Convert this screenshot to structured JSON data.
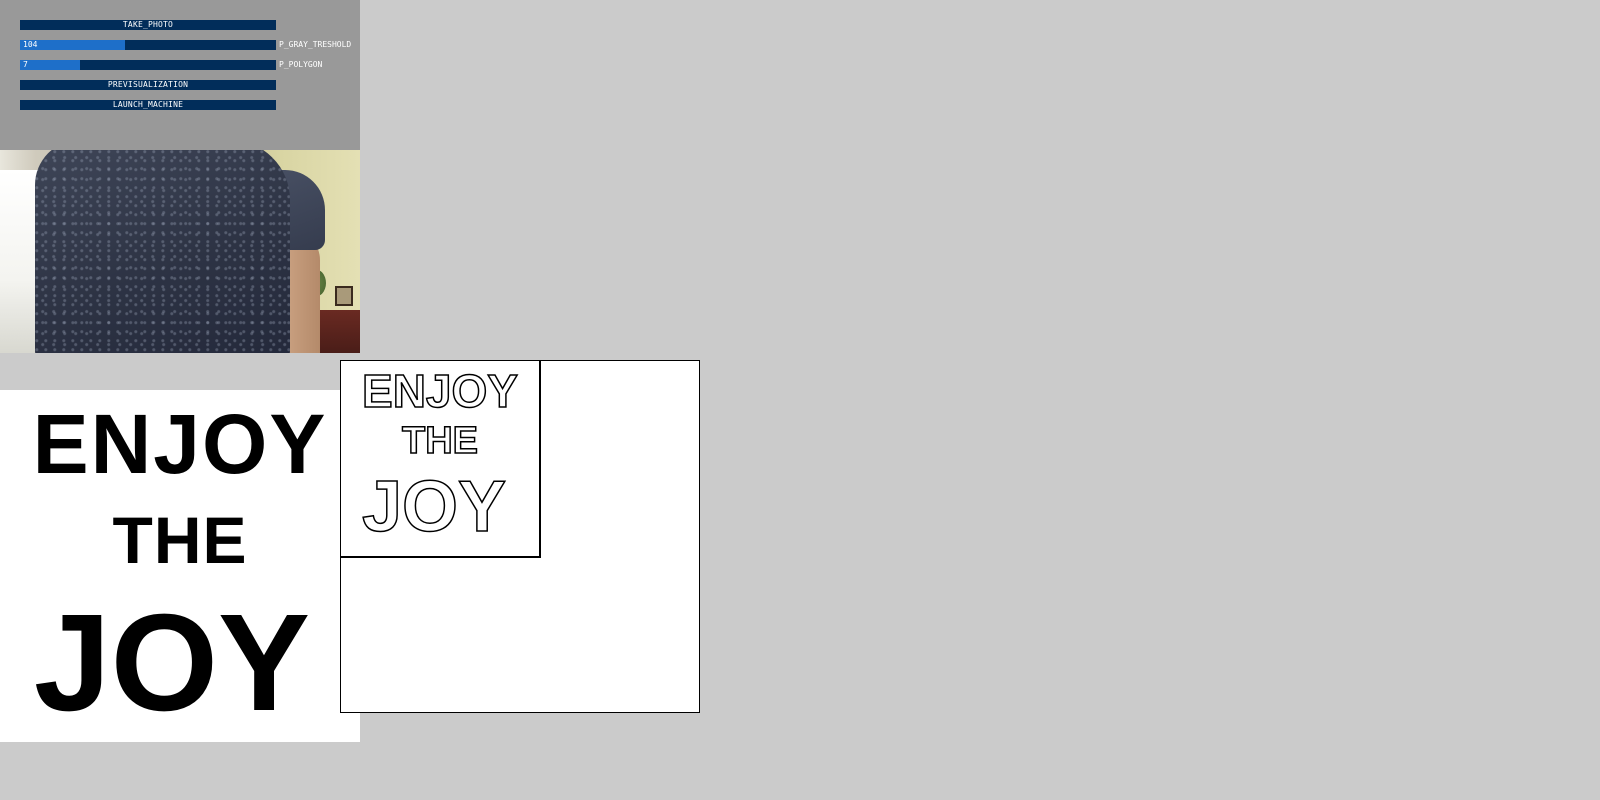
{
  "controls": {
    "take_photo_label": "TAKE_PHOTO",
    "gray_threshold": {
      "value": "104",
      "label": "P_GRAY_TRESHOLD",
      "fraction": 0.41
    },
    "polygon": {
      "value": "7",
      "label": "P_POLYGON",
      "fraction": 0.235
    },
    "previsualization_label": "PREVISUALIZATION",
    "launch_machine_label": "LAUNCH_MACHINE"
  },
  "source_image": {
    "line1": "ENJOY",
    "line2": "THE",
    "line3": "JOY"
  },
  "preview": {
    "line1": "ENJOY",
    "line2": "THE",
    "line3": "JOY"
  },
  "colors": {
    "background": "#cbcbcb",
    "panel": "#999999",
    "control_bg": "#012d5a",
    "control_active": "#1e6fc9"
  }
}
